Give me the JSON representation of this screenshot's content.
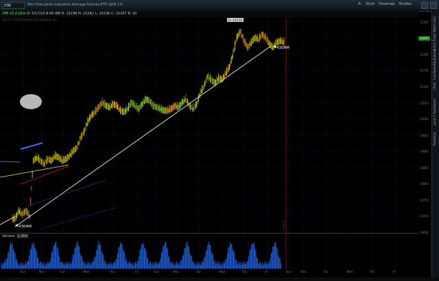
{
  "window": {
    "symbol": "/YM",
    "title": "Mini Dow Jones Industrial Average Futures,ETH (JUN 13)",
    "toolbar": [
      {
        "label": "Style",
        "icon": "style-icon"
      },
      {
        "label": "Drawings",
        "icon": "drawings-icon"
      },
      {
        "label": "Studies",
        "icon": "studies-icon"
      }
    ],
    "right_toolbar_label": "A-"
  },
  "quote": {
    "period": "/YM 15 d 15m",
    "date": "D: 5/17/13 8:45 AM",
    "open": "O: 15236",
    "high": "H: 15241",
    "low": "L: 15236",
    "close": "C: 15237",
    "range": "R: 10"
  },
  "copyright": "2013 © TD Ameritrade IP Company, Inc.",
  "price_axis": {
    "labels": [
      "15300",
      "15250",
      "15200",
      "15150",
      "15100",
      "15050",
      "15000",
      "14950",
      "14900",
      "14850",
      "14800",
      "14750",
      "14700",
      "14650"
    ],
    "last_price": "15237"
  },
  "volume": {
    "label": "Volume",
    "value": "2,364"
  },
  "annotations": {
    "high_label": "H: 15270",
    "time_label_right": "430AM",
    "time_label_left": "430AM",
    "marker_label": "4/30/13"
  },
  "time_axis": [
    {
      "label": "Sun",
      "pos": 0.055
    },
    {
      "label": "Mon",
      "pos": 0.1
    },
    {
      "label": "Tue",
      "pos": 0.15
    },
    {
      "label": "Wed",
      "pos": 0.205
    },
    {
      "label": "Thu",
      "pos": 0.268
    },
    {
      "label": "Fri",
      "pos": 0.33
    },
    {
      "label": "Sun",
      "pos": 0.375
    },
    {
      "label": "Mon",
      "pos": 0.42
    },
    {
      "label": "Tue",
      "pos": 0.475
    },
    {
      "label": "Wed",
      "pos": 0.53
    },
    {
      "label": "Thu",
      "pos": 0.585
    },
    {
      "label": "Fri",
      "pos": 0.64
    },
    {
      "label": "Sun",
      "pos": 0.69
    },
    {
      "label": "Mon",
      "pos": 0.725
    },
    {
      "label": "Tue",
      "pos": 0.78
    },
    {
      "label": "Wed",
      "pos": 0.835
    },
    {
      "label": "Thu",
      "pos": 0.89
    },
    {
      "label": "Fri",
      "pos": 0.945
    }
  ],
  "sidebar_tabs": [
    "Watch Lists",
    "Active Trader",
    "Big Buttons",
    "Live News",
    "Chart",
    "Dashboard",
    "Level II",
    "Tradetools"
  ],
  "chart_data": {
    "type": "line",
    "series": [
      {
        "values": [
          14690,
          14715,
          14705,
          14715,
          14700,
          14870,
          14880,
          14870,
          14860,
          14875,
          14870,
          14885,
          14880,
          14870,
          14875,
          14885,
          14900,
          14910,
          14940,
          14960,
          14990,
          15010,
          15020,
          15035,
          15050,
          15040,
          15035,
          15045,
          15040,
          15025,
          15020,
          15030,
          15050,
          15040,
          15030,
          15045,
          15060,
          15055,
          15040,
          15035,
          15030,
          15025,
          15025,
          15030,
          15040,
          15035,
          15050,
          15060,
          15040,
          15030,
          15045,
          15080,
          15100,
          15130,
          15120,
          15110,
          15125,
          15120,
          15140,
          15160,
          15200,
          15250,
          15270,
          15240,
          15220,
          15235,
          15250,
          15245,
          15260,
          15250,
          15230,
          15220,
          15235,
          15240,
          15236
        ]
      }
    ],
    "ylim": [
      14650,
      15310
    ],
    "colors": {
      "bar_up": "#d4c416",
      "bar_mix": "#c8501e",
      "bar_down": "#2fa02f",
      "volume": "#1e5fd8",
      "trendline": "#c9c9c9",
      "marker": "#a0203a"
    }
  }
}
